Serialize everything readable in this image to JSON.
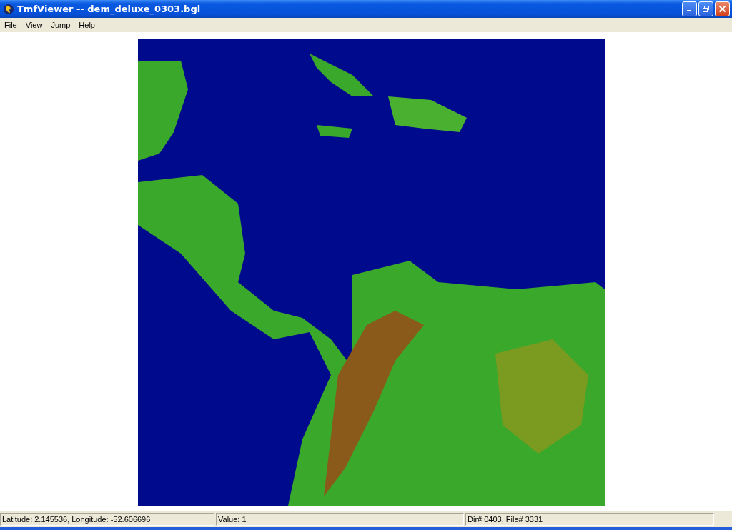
{
  "window": {
    "title": "TmfViewer -- dem_deluxe_0303.bgl"
  },
  "menu": [
    "File",
    "View",
    "Jump",
    "Help"
  ],
  "status_bar": [
    "Latitude: 2.145536, Longitude: -52.606696",
    "Value: 1",
    "Dir# 0403, File# 3331"
  ]
}
